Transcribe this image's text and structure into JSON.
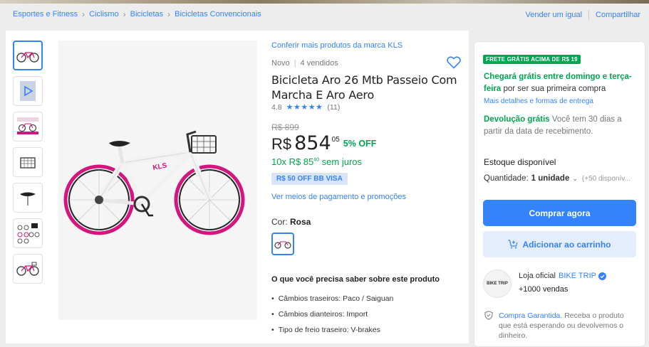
{
  "breadcrumb": [
    "Esportes e Fitness",
    "Ciclismo",
    "Bicicletas",
    "Bicicletas Convencionais"
  ],
  "top_links": {
    "sell": "Vender um igual",
    "share": "Compartilhar"
  },
  "product": {
    "brand_link": "Conferir mais produtos da marca KLS",
    "condition": "Novo",
    "sold": "4 vendidos",
    "title": "Bicicleta Aro 26 Mtb Passeio Com Marcha E Aro Aero",
    "rating": "4.8",
    "stars": "★★★★★",
    "reviews": "(11)",
    "old_price": "R$ 899",
    "currency": "R$",
    "price": "854",
    "cents": "05",
    "discount": "5% OFF",
    "installments": "10x R$ 85",
    "installments_cents": "40",
    "installments_suffix": " sem juros",
    "promo_badge": "R$ 50 OFF BB VISA",
    "payment_link": "Ver meios de pagamento e promoções",
    "color_label": "Cor:",
    "color_value": "Rosa",
    "features_title": "O que você precisa saber sobre este produto",
    "features": [
      "Câmbios traseiros: Paco / Saiguan",
      "Câmbios dianteiros: Import",
      "Tipo de freio traseiro: V-brakes"
    ]
  },
  "side": {
    "frete_badge": "FRETE GRÁTIS ACIMA DE R$ 19",
    "ship_green": "Chegará grátis entre domingo e terça-feira",
    "ship_rest": " por ser sua primeira compra",
    "ship_more": "Mais detalhes e formas de entrega",
    "return_green": "Devolução grátis",
    "return_rest": " Você tem 30 dias a partir da data de recebimento.",
    "stock": "Estoque disponível",
    "qty_label": "Quantidade:",
    "qty_value": "1 unidade",
    "qty_avail": "(+50 disponív...",
    "buy_button": "Comprar agora",
    "cart_button": "Adicionar ao carrinho",
    "seller_prefix": "Loja oficial",
    "seller_name": "BIKE TRIP",
    "seller_sales": "+1000 vendas",
    "seller_logo_text": "BIKE TRIP",
    "guarantee_link": "Compra Garantida.",
    "guarantee_rest": " Receba o produto que está esperando ou devolvemos o dinheiro."
  },
  "colors": {
    "accent": "#3483fa",
    "green": "#00a650",
    "pink": "#d4157f"
  }
}
